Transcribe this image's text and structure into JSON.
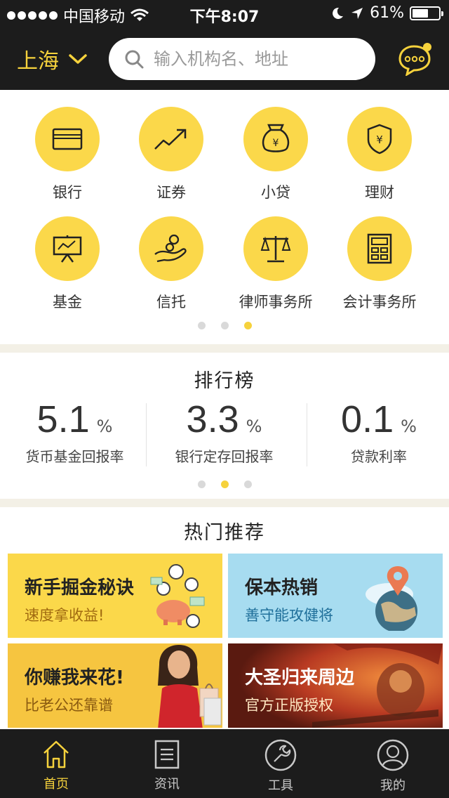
{
  "status_bar": {
    "carrier": "中国移动",
    "time": "下午8:07",
    "battery": "61%",
    "battery_level": 0.61
  },
  "header": {
    "city": "上海",
    "search_placeholder": "输入机构名、地址"
  },
  "categories": [
    {
      "label": "银行",
      "icon": "bank-card-icon"
    },
    {
      "label": "证券",
      "icon": "stock-trend-icon"
    },
    {
      "label": "小贷",
      "icon": "money-bag-icon"
    },
    {
      "label": "理财",
      "icon": "shield-yuan-icon"
    },
    {
      "label": "基金",
      "icon": "presentation-chart-icon"
    },
    {
      "label": "信托",
      "icon": "hand-coin-icon"
    },
    {
      "label": "律师事务所",
      "icon": "scales-icon"
    },
    {
      "label": "会计事务所",
      "icon": "calculator-icon"
    }
  ],
  "ranking": {
    "title": "排行榜",
    "items": [
      {
        "value": "5.1",
        "unit": "%",
        "label": "货币基金回报率"
      },
      {
        "value": "3.3",
        "unit": "%",
        "label": "银行定存回报率"
      },
      {
        "value": "0.1",
        "unit": "%",
        "label": "贷款利率"
      }
    ]
  },
  "hot": {
    "title": "热门推荐",
    "cards": [
      {
        "title": "新手掘金秘诀",
        "subtitle": "速度拿收益!",
        "bg": "#fbd84a",
        "sub_color": "#a06a10"
      },
      {
        "title": "保本热销",
        "subtitle": "善守能攻健将",
        "bg": "#a7dcf0",
        "sub_color": "#1f6f9a"
      },
      {
        "title": "你赚我来花!",
        "subtitle": "比老公还靠谱",
        "bg": "#f6c540",
        "sub_color": "#8a5a10"
      },
      {
        "title": "大圣归来周边",
        "subtitle": "官方正版授权",
        "bg": "#b83a22",
        "sub_color": "#ffe7c2"
      }
    ]
  },
  "tabs": [
    {
      "label": "首页",
      "icon": "home-icon",
      "active": true
    },
    {
      "label": "资讯",
      "icon": "news-icon",
      "active": false
    },
    {
      "label": "工具",
      "icon": "wrench-icon",
      "active": false
    },
    {
      "label": "我的",
      "icon": "user-icon",
      "active": false
    }
  ],
  "colors": {
    "accent": "#f6d23c",
    "dark": "#1c1c1c"
  }
}
